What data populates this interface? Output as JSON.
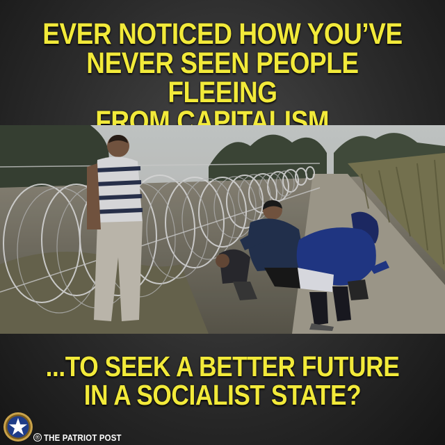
{
  "meme": {
    "top_caption": [
      "EVER NOTICED HOW YOU’VE",
      "NEVER SEEN PEOPLE FLEEING",
      "FROM CAPITALISM..."
    ],
    "bottom_caption": [
      "...TO SEEK A BETTER FUTURE",
      "IN A SOCIALIST STATE?"
    ],
    "caption_color": "#f2ea3a"
  },
  "branding": {
    "logo_icon": "star-seal-icon",
    "registered_mark": "®",
    "name": "THE PATRIOT POST"
  }
}
